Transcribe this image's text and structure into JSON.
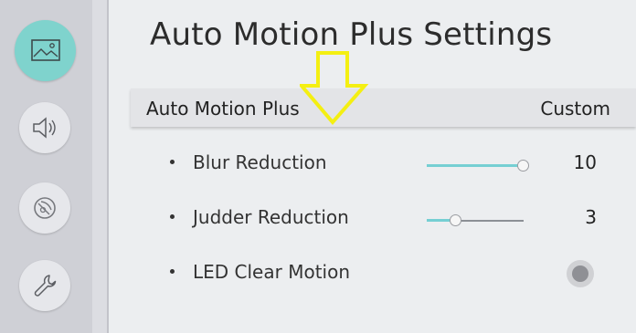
{
  "sidebar": {
    "items": [
      {
        "icon": "picture-icon",
        "active": true
      },
      {
        "icon": "sound-icon",
        "active": false
      },
      {
        "icon": "broadcasting-icon",
        "active": false
      },
      {
        "icon": "support-wrench-icon",
        "active": false
      }
    ]
  },
  "page": {
    "title": "Auto Motion Plus Settings"
  },
  "header": {
    "label": "Auto Motion Plus",
    "value": "Custom"
  },
  "settings": [
    {
      "label": "Blur Reduction",
      "type": "slider",
      "value": "10",
      "min": 0,
      "max": 10,
      "level": 10
    },
    {
      "label": "Judder Reduction",
      "type": "slider",
      "value": "3",
      "min": 0,
      "max": 10,
      "level": 3
    },
    {
      "label": "LED Clear Motion",
      "type": "toggle",
      "state": "off"
    }
  ],
  "colors": {
    "accent": "#7fd3cd",
    "slider_fill": "#75cfd3",
    "annotation_arrow": "#f4ef12"
  }
}
